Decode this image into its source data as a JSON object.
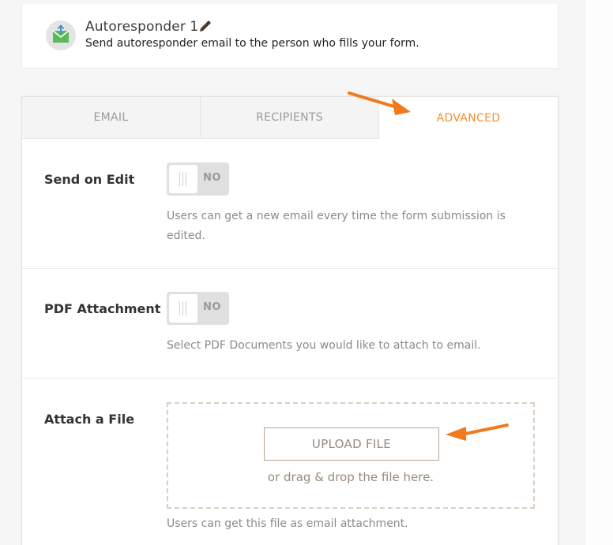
{
  "header": {
    "title": "Autoresponder 1",
    "description": "Send autoresponder email to the person who fills your form.",
    "icon": "envelope-icon",
    "edit_icon": "pencil-icon"
  },
  "tabs": [
    {
      "label": "EMAIL",
      "active": false
    },
    {
      "label": "RECIPIENTS",
      "active": false
    },
    {
      "label": "ADVANCED",
      "active": true
    }
  ],
  "settings": {
    "send_on_edit": {
      "label": "Send on Edit",
      "toggle_state": "NO",
      "help": "Users can get a new email every time the form submission is edited."
    },
    "pdf_attachment": {
      "label": "PDF Attachment",
      "toggle_state": "NO",
      "help": "Select PDF Documents you would like to attach to email."
    },
    "attach_file": {
      "label": "Attach a File",
      "upload_button": "UPLOAD FILE",
      "drop_text": "or drag & drop the file here.",
      "help": "Users can get this file as email attachment."
    }
  },
  "colors": {
    "accent": "#f2902e",
    "annotation_arrow": "#f07a1c"
  }
}
